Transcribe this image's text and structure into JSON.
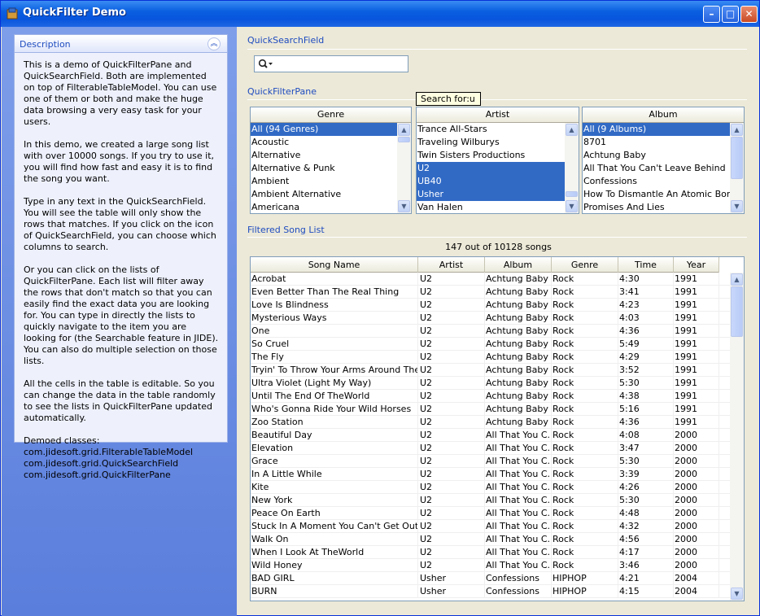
{
  "window": {
    "title": "QuickFilter Demo",
    "minimize": "–",
    "maximize": "□",
    "close": "✕"
  },
  "description": {
    "header": "Description",
    "collapse_icon": "chevron-double-up-icon",
    "paragraphs": [
      "This is a demo of QuickFilterPane and QuickSearchField. Both are implemented on top of FilterableTableModel. You can use one of them or both and make the huge data browsing a very easy task for your users.",
      "In this demo, we created a large song list with over 10000 songs. If you try to use it, you will find how fast and easy it is to find the song you want.",
      "Type in any text in the QuickSearchField. You will see the table will only show the rows that matches. If you click on the icon of QuickSearchField, you can choose which columns to search.",
      "Or you can click on the lists of QuickFilterPane. Each list will filter away the rows that don't match so that you can easily find the exact data you are looking for. You can type in directly the lists to quickly navigate to the item you are looking for (the Searchable feature in JIDE). You can also do multiple selection on those lists.",
      "All the cells in the table is editable. So you can change the data in the table randomly to see the lists in QuickFilterPane updated automatically."
    ],
    "demoed_title": "Demoed classes:",
    "demoed_classes": [
      "com.jidesoft.grid.FilterableTableModel",
      "com.jidesoft.grid.QuickSearchField",
      "com.jidesoft.grid.QuickFilterPane"
    ]
  },
  "quick_search": {
    "title": "QuickSearchField",
    "value": ""
  },
  "quick_filter": {
    "title": "QuickFilterPane",
    "tooltip": "Search for:u",
    "lists": [
      {
        "header": "Genre",
        "items": [
          {
            "label": "All (94 Genres)",
            "selected": true
          },
          {
            "label": "Acoustic",
            "selected": false
          },
          {
            "label": "Alternative",
            "selected": false
          },
          {
            "label": "Alternative & Punk",
            "selected": false
          },
          {
            "label": "Ambient",
            "selected": false
          },
          {
            "label": "Ambient Alternative",
            "selected": false
          },
          {
            "label": "Americana",
            "selected": false
          }
        ]
      },
      {
        "header": "Artist",
        "items": [
          {
            "label": "Trance All-Stars",
            "selected": false
          },
          {
            "label": "Traveling Wilburys",
            "selected": false
          },
          {
            "label": "Twin Sisters Productions",
            "selected": false
          },
          {
            "label": "U2",
            "selected": true
          },
          {
            "label": "UB40",
            "selected": true
          },
          {
            "label": "Usher",
            "selected": true
          },
          {
            "label": "Van Halen",
            "selected": false
          }
        ]
      },
      {
        "header": "Album",
        "items": [
          {
            "label": "All (9 Albums)",
            "selected": true
          },
          {
            "label": "8701",
            "selected": false
          },
          {
            "label": "Achtung Baby",
            "selected": false
          },
          {
            "label": "All That You Can't Leave Behind",
            "selected": false
          },
          {
            "label": "Confessions",
            "selected": false
          },
          {
            "label": "How To Dismantle An Atomic Bomb",
            "selected": false
          },
          {
            "label": "Promises And Lies",
            "selected": false
          }
        ]
      }
    ]
  },
  "song_list": {
    "title": "Filtered Song List",
    "count_text": "147 out of 10128 songs",
    "columns": [
      "Song Name",
      "Artist",
      "Album",
      "Genre",
      "Time",
      "Year"
    ],
    "rows": [
      [
        "Acrobat",
        "U2",
        "Achtung Baby",
        "Rock",
        "4:30",
        "1991"
      ],
      [
        "Even Better Than The Real Thing",
        "U2",
        "Achtung Baby",
        "Rock",
        "3:41",
        "1991"
      ],
      [
        "Love Is Blindness",
        "U2",
        "Achtung Baby",
        "Rock",
        "4:23",
        "1991"
      ],
      [
        "Mysterious Ways",
        "U2",
        "Achtung Baby",
        "Rock",
        "4:03",
        "1991"
      ],
      [
        "One",
        "U2",
        "Achtung Baby",
        "Rock",
        "4:36",
        "1991"
      ],
      [
        "So Cruel",
        "U2",
        "Achtung Baby",
        "Rock",
        "5:49",
        "1991"
      ],
      [
        "The Fly",
        "U2",
        "Achtung Baby",
        "Rock",
        "4:29",
        "1991"
      ],
      [
        "Tryin' To Throw Your Arms Around The...",
        "U2",
        "Achtung Baby",
        "Rock",
        "3:52",
        "1991"
      ],
      [
        "Ultra Violet (Light My Way)",
        "U2",
        "Achtung Baby",
        "Rock",
        "5:30",
        "1991"
      ],
      [
        "Until The End Of TheWorld",
        "U2",
        "Achtung Baby",
        "Rock",
        "4:38",
        "1991"
      ],
      [
        " Who's Gonna Ride Your Wild Horses",
        "U2",
        "Achtung Baby",
        "Rock",
        "5:16",
        "1991"
      ],
      [
        "Zoo Station",
        "U2",
        "Achtung Baby",
        "Rock",
        "4:36",
        "1991"
      ],
      [
        "Beautiful Day",
        "U2",
        "All That You C...",
        "Rock",
        "4:08",
        "2000"
      ],
      [
        "Elevation",
        "U2",
        "All That You C...",
        "Rock",
        "3:47",
        "2000"
      ],
      [
        "Grace",
        "U2",
        "All That You C...",
        "Rock",
        "5:30",
        "2000"
      ],
      [
        "In A Little While",
        "U2",
        "All That You C...",
        "Rock",
        "3:39",
        "2000"
      ],
      [
        "Kite",
        "U2",
        "All That You C...",
        "Rock",
        "4:26",
        "2000"
      ],
      [
        "New York",
        "U2",
        "All That You C...",
        "Rock",
        "5:30",
        "2000"
      ],
      [
        "Peace On Earth",
        "U2",
        "All That You C...",
        "Rock",
        "4:48",
        "2000"
      ],
      [
        "Stuck In A Moment You Can't Get Out Of",
        "U2",
        "All That You C...",
        "Rock",
        "4:32",
        "2000"
      ],
      [
        " Walk On",
        "U2",
        "All That You C...",
        "Rock",
        "4:56",
        "2000"
      ],
      [
        " When I Look At TheWorld",
        "U2",
        "All That You C...",
        "Rock",
        "4:17",
        "2000"
      ],
      [
        " Wild Honey",
        "U2",
        "All That You C...",
        "Rock",
        "3:46",
        "2000"
      ],
      [
        "BAD GIRL",
        "Usher",
        "Confessions",
        "HIPHOP",
        "4:21",
        "2004"
      ],
      [
        "BURN",
        "Usher",
        "Confessions",
        "HIPHOP",
        "4:15",
        "2004"
      ]
    ]
  },
  "colors": {
    "selection": "#316ac5",
    "section_title": "#1f4cbf",
    "titlebar": "#0a5fe0"
  }
}
